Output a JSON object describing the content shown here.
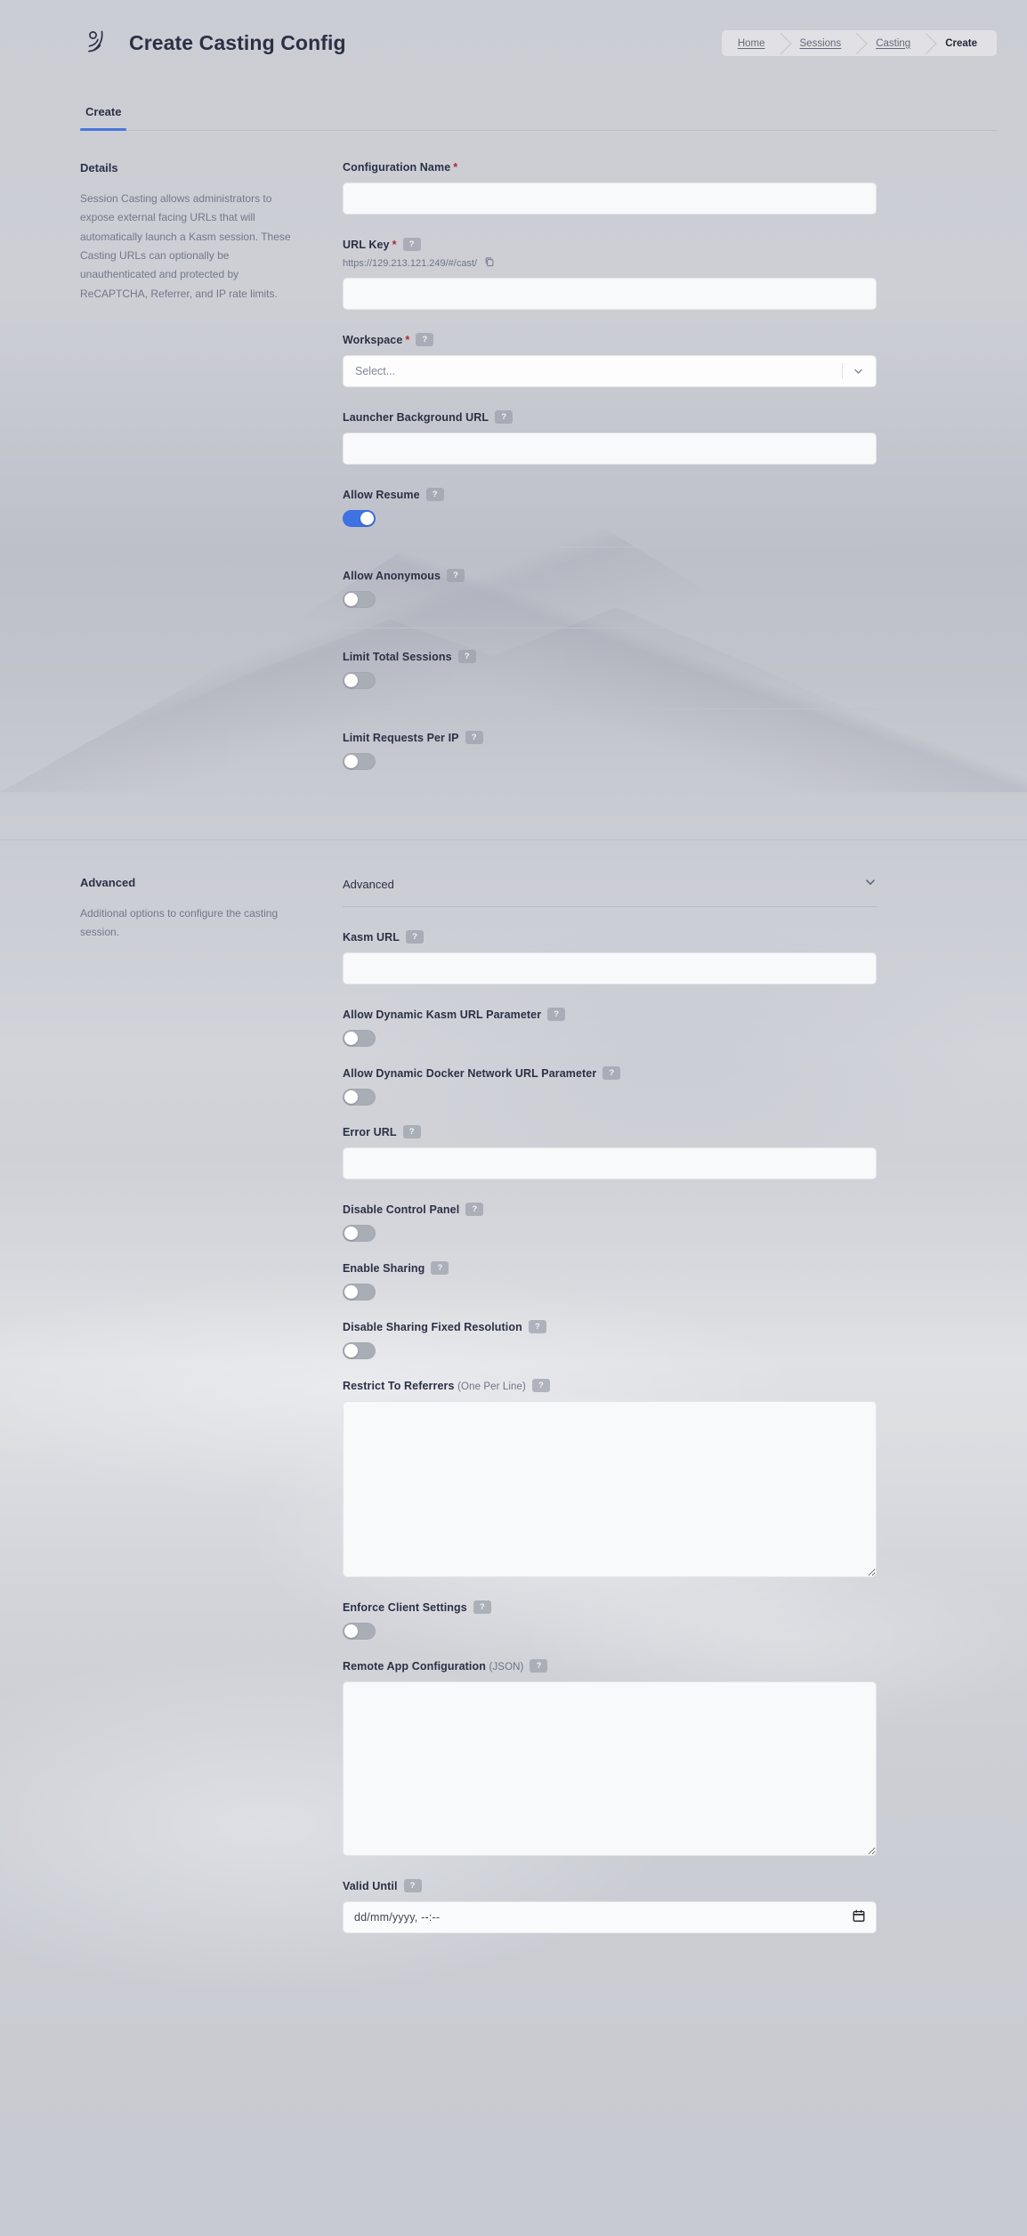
{
  "header": {
    "logo_icon": "kasm-logo-icon",
    "title": "Create Casting Config",
    "breadcrumb": [
      {
        "label": "Home",
        "active": false
      },
      {
        "label": "Sessions",
        "active": false
      },
      {
        "label": "Casting",
        "active": false
      },
      {
        "label": "Create",
        "active": true
      }
    ]
  },
  "tabs": [
    {
      "label": "Create",
      "selected": true
    }
  ],
  "details": {
    "heading": "Details",
    "description": "Session Casting allows administrators to expose external facing URLs that will automatically launch a Kasm session. These Casting URLs can optionally be unauthenticated and protected by ReCAPTCHA, Referrer, and IP rate limits."
  },
  "advanced_side": {
    "heading": "Advanced",
    "description": "Additional options to configure the casting session."
  },
  "advanced_header": {
    "title": "Advanced",
    "chevron_icon": "chevron-down-icon"
  },
  "help_glyph": "?",
  "required_glyph": "*",
  "fields": {
    "configuration_name": {
      "label": "Configuration Name",
      "required": true,
      "value": "",
      "placeholder": ""
    },
    "url_key": {
      "label": "URL Key",
      "required": true,
      "help": "?",
      "hint": "https://129.213.121.249/#/cast/",
      "copy_icon": "copy-icon",
      "value": "",
      "placeholder": ""
    },
    "workspace": {
      "label": "Workspace",
      "required": true,
      "help": "?",
      "selected": "Select...",
      "arrow_icon": "chevron-down-icon"
    },
    "launcher_background_url": {
      "label": "Launcher Background URL",
      "help": "?",
      "value": "",
      "placeholder": ""
    },
    "kasm_url": {
      "label": "Kasm URL",
      "help": "?",
      "value": "",
      "placeholder": ""
    },
    "error_url": {
      "label": "Error URL",
      "help": "?",
      "value": "",
      "placeholder": ""
    },
    "restrict_to_referrers": {
      "label": "Restrict To Referrers",
      "sub_label": "(One Per Line)",
      "help": "?",
      "value": "",
      "placeholder": ""
    },
    "remote_app_configuration": {
      "label": "Remote App Configuration",
      "sub_label": "(JSON)",
      "help": "?",
      "value": "",
      "placeholder": ""
    },
    "valid_until": {
      "label": "Valid Until",
      "help": "?",
      "placeholder": "dd/mm/yyyy, --:--",
      "value": "",
      "calendar_icon": "calendar-icon"
    }
  },
  "toggles": {
    "allow_resume": {
      "label": "Allow Resume",
      "help": "?",
      "on": true
    },
    "allow_anonymous": {
      "label": "Allow Anonymous",
      "help": "?",
      "on": false
    },
    "limit_total_sessions": {
      "label": "Limit Total Sessions",
      "help": "?",
      "on": false
    },
    "limit_requests_per_ip": {
      "label": "Limit Requests Per IP",
      "help": "?",
      "on": false
    },
    "allow_dynamic_kasm_url": {
      "label": "Allow Dynamic Kasm URL Parameter",
      "help": "?",
      "on": false
    },
    "allow_dynamic_docker_network_url": {
      "label": "Allow Dynamic Docker Network URL Parameter",
      "help": "?",
      "on": false
    },
    "disable_control_panel": {
      "label": "Disable Control Panel",
      "help": "?",
      "on": false
    },
    "enable_sharing": {
      "label": "Enable Sharing",
      "help": "?",
      "on": false
    },
    "disable_sharing_fixed_resolution": {
      "label": "Disable Sharing Fixed Resolution",
      "help": "?",
      "on": false
    },
    "enforce_client_settings": {
      "label": "Enforce Client Settings",
      "help": "?",
      "on": false
    }
  },
  "colors": {
    "accent": "#3f72e3",
    "tab_underline": "#4a77df",
    "required_asterisk": "#b02a2a",
    "page_bg": "#cfd1d7",
    "input_bg": "#f8f9fa",
    "toggle_off": "#a9adb6"
  }
}
